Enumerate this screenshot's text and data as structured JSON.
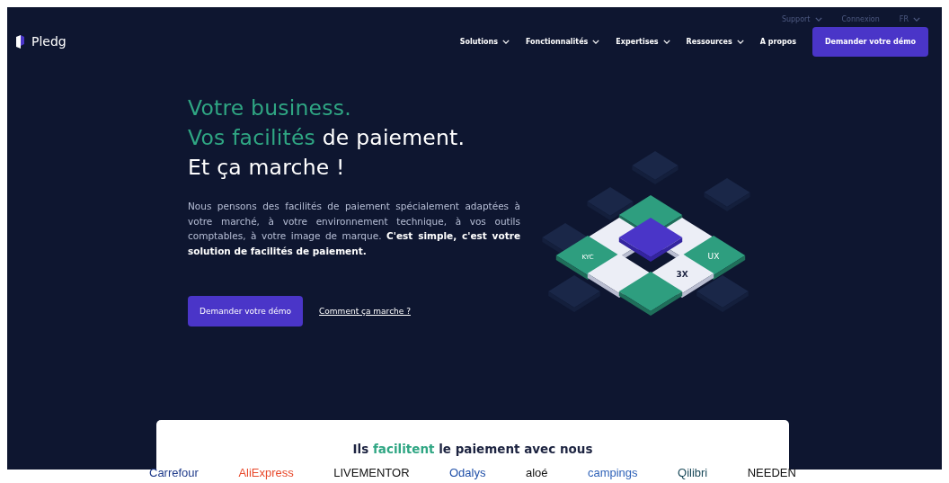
{
  "top_bar": {
    "links": [
      {
        "label": "Support",
        "dropdown": true
      },
      {
        "label": "Connexion",
        "dropdown": false
      },
      {
        "label": "FR",
        "dropdown": true
      }
    ]
  },
  "header": {
    "logo": "Pledg",
    "nav": [
      {
        "label": "Solutions",
        "dropdown": true
      },
      {
        "label": "Fonctionnalités",
        "dropdown": true
      },
      {
        "label": "Expertises",
        "dropdown": true
      },
      {
        "label": "Ressources",
        "dropdown": true
      },
      {
        "label": "A propos",
        "dropdown": false
      }
    ],
    "cta": "Demander votre démo"
  },
  "hero": {
    "headline": [
      [
        {
          "text": "Votre business.",
          "accent": true
        }
      ],
      [
        {
          "text": "Vos facilités",
          "accent": true
        },
        {
          "text": " de paiement.",
          "accent": false
        }
      ],
      [
        {
          "text": "Et ça marche !",
          "accent": false
        }
      ]
    ],
    "description": "Nous pensons des facilités de paiement spécialement adaptées à votre marché, à votre environnement technique, à vos outils comptables, à votre image de marque. **C'est simple, c'est votre solution de facilités de paiement.**",
    "primary_button": "Demander votre démo",
    "secondary_link": "Comment ça marche ?",
    "illustration_labels": [
      "KYC",
      "UX",
      "3X"
    ]
  },
  "partners": {
    "title": [
      {
        "text": "Ils ",
        "accent": false
      },
      {
        "text": "facilitent",
        "accent": true
      },
      {
        "text": " le paiement avec nous",
        "accent": false
      }
    ],
    "logos": [
      {
        "text": "Carrefour",
        "color": "#1e3a8a"
      },
      {
        "text": "AliExpress",
        "color": "#e8492b"
      },
      {
        "text": "LIVEMENTOR",
        "color": "#111111"
      },
      {
        "text": "Odalys",
        "color": "#1f4fa8"
      },
      {
        "text": "aloé",
        "color": "#111111"
      },
      {
        "text": "campings",
        "color": "#2f62b8"
      },
      {
        "text": "Qilibri",
        "color": "#1b4a5a"
      },
      {
        "text": "NEEDEN",
        "color": "#111111"
      }
    ]
  }
}
